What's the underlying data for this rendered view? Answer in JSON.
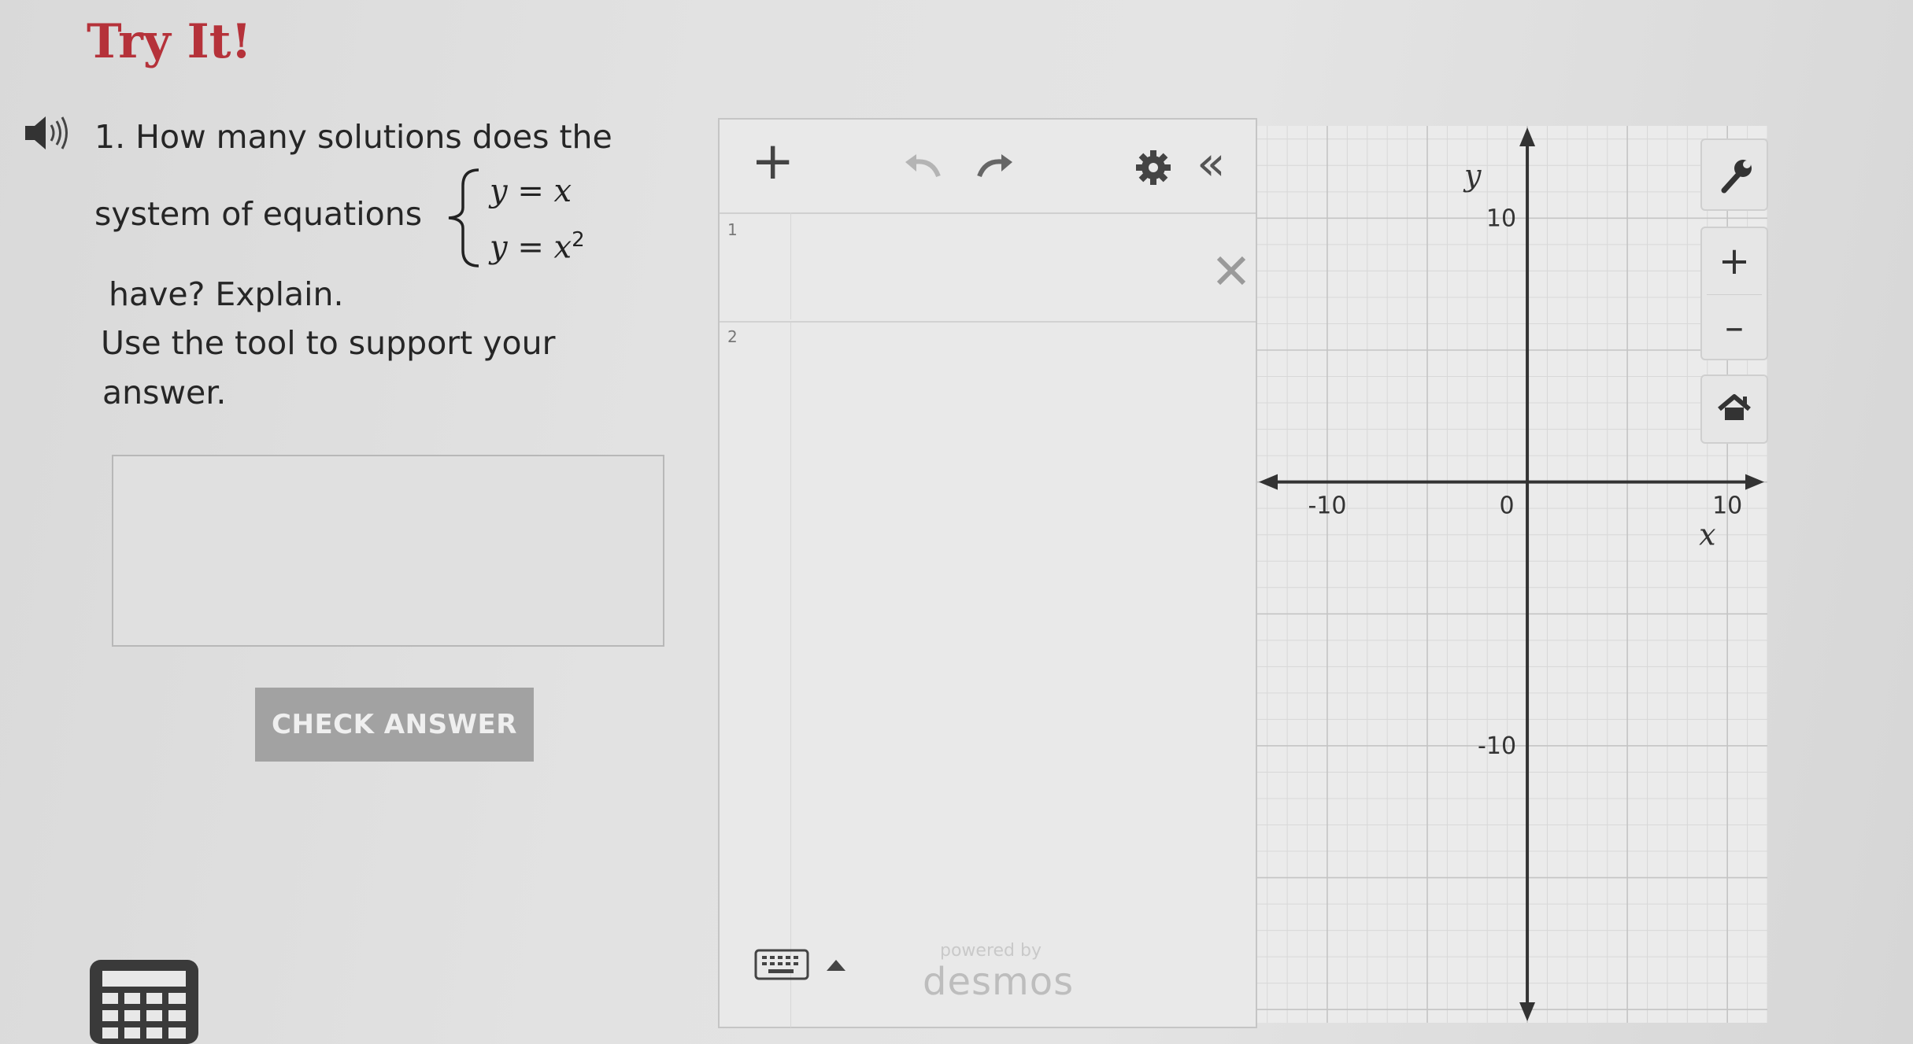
{
  "title": "Try It!",
  "question": {
    "line1": "1. How many solutions does the",
    "line2": "system of equations",
    "line3": "have? Explain.",
    "line4": "Use the tool to support your",
    "line5": "answer.",
    "equation1": "y = x",
    "equation2_base": "y = x",
    "equation2_exp": "2"
  },
  "answer": {
    "placeholder": ""
  },
  "check_answer_label": "CHECK ANSWER",
  "desmos": {
    "add_label": "+",
    "collapse_label": "«",
    "rows": [
      {
        "number": "1"
      },
      {
        "number": "2"
      }
    ],
    "powered_by": "powered by",
    "logo": "desmos"
  },
  "graph": {
    "y_label": "y",
    "x_label": "x",
    "ticks": {
      "x_min": "-10",
      "x_max": "10",
      "y_max": "10",
      "y_min": "-10",
      "origin": "0"
    },
    "x_range": [
      -13.5,
      12
    ],
    "y_range": [
      -20.5,
      13.5
    ],
    "zoom_plus": "+",
    "zoom_minus": "–"
  }
}
